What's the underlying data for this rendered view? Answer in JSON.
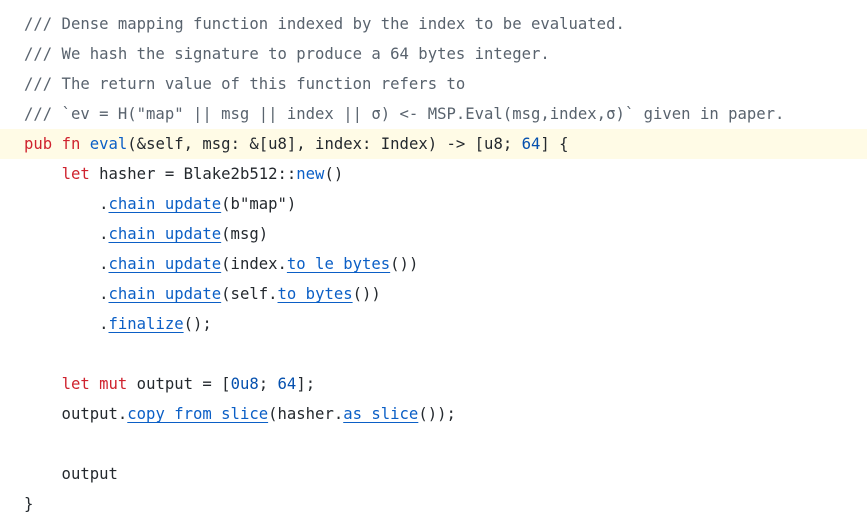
{
  "code": {
    "lines": [
      {
        "tokens": [
          {
            "t": "c",
            "v": "/// Dense mapping function indexed by the index to be evaluated."
          }
        ]
      },
      {
        "tokens": [
          {
            "t": "c",
            "v": "/// We hash the signature to produce a 64 bytes integer."
          }
        ]
      },
      {
        "tokens": [
          {
            "t": "c",
            "v": "/// The return value of this function refers to"
          }
        ]
      },
      {
        "tokens": [
          {
            "t": "c",
            "v": "/// `ev = H(\"map\" || msg || index || σ) <- MSP.Eval(msg,index,σ)` given in paper."
          }
        ]
      },
      {
        "highlight": true,
        "tokens": [
          {
            "t": "k",
            "v": "pub"
          },
          {
            "t": "p",
            "v": " "
          },
          {
            "t": "k",
            "v": "fn"
          },
          {
            "t": "p",
            "v": " "
          },
          {
            "t": "f",
            "v": "eval"
          },
          {
            "t": "p",
            "v": "(&self, msg: &[u8], index: Index) -> [u8; "
          },
          {
            "t": "n",
            "v": "64"
          },
          {
            "t": "p",
            "v": "] {"
          }
        ]
      },
      {
        "tokens": [
          {
            "t": "p",
            "v": "    "
          },
          {
            "t": "k",
            "v": "let"
          },
          {
            "t": "p",
            "v": " hasher = Blake2b512::"
          },
          {
            "t": "f",
            "v": "new"
          },
          {
            "t": "p",
            "v": "()"
          }
        ]
      },
      {
        "tokens": [
          {
            "t": "p",
            "v": "        ."
          },
          {
            "t": "m",
            "v": "chain_update"
          },
          {
            "t": "p",
            "v": "(b\"map\")"
          }
        ]
      },
      {
        "tokens": [
          {
            "t": "p",
            "v": "        ."
          },
          {
            "t": "m",
            "v": "chain_update"
          },
          {
            "t": "p",
            "v": "(msg)"
          }
        ]
      },
      {
        "tokens": [
          {
            "t": "p",
            "v": "        ."
          },
          {
            "t": "m",
            "v": "chain_update"
          },
          {
            "t": "p",
            "v": "(index."
          },
          {
            "t": "m",
            "v": "to_le_bytes"
          },
          {
            "t": "p",
            "v": "())"
          }
        ]
      },
      {
        "tokens": [
          {
            "t": "p",
            "v": "        ."
          },
          {
            "t": "m",
            "v": "chain_update"
          },
          {
            "t": "p",
            "v": "(self."
          },
          {
            "t": "m",
            "v": "to_bytes"
          },
          {
            "t": "p",
            "v": "())"
          }
        ]
      },
      {
        "tokens": [
          {
            "t": "p",
            "v": "        ."
          },
          {
            "t": "m",
            "v": "finalize"
          },
          {
            "t": "p",
            "v": "();"
          }
        ]
      },
      {
        "tokens": [
          {
            "t": "p",
            "v": ""
          }
        ]
      },
      {
        "tokens": [
          {
            "t": "p",
            "v": "    "
          },
          {
            "t": "k",
            "v": "let"
          },
          {
            "t": "p",
            "v": " "
          },
          {
            "t": "k",
            "v": "mut"
          },
          {
            "t": "p",
            "v": " output = ["
          },
          {
            "t": "n",
            "v": "0u8"
          },
          {
            "t": "p",
            "v": "; "
          },
          {
            "t": "n",
            "v": "64"
          },
          {
            "t": "p",
            "v": "];"
          }
        ]
      },
      {
        "tokens": [
          {
            "t": "p",
            "v": "    output."
          },
          {
            "t": "m",
            "v": "copy_from_slice"
          },
          {
            "t": "p",
            "v": "(hasher."
          },
          {
            "t": "m",
            "v": "as_slice"
          },
          {
            "t": "p",
            "v": "());"
          }
        ]
      },
      {
        "tokens": [
          {
            "t": "p",
            "v": ""
          }
        ]
      },
      {
        "tokens": [
          {
            "t": "p",
            "v": "    output"
          }
        ]
      },
      {
        "tokens": [
          {
            "t": "p",
            "v": "}"
          }
        ]
      }
    ]
  },
  "colors": {
    "background": "#ffffff",
    "highlight_line": "#fffbe6",
    "comment": "#59636e",
    "keyword": "#cf222e",
    "function": "#0b5fc6",
    "number": "#0550ae",
    "text": "#24292e"
  }
}
